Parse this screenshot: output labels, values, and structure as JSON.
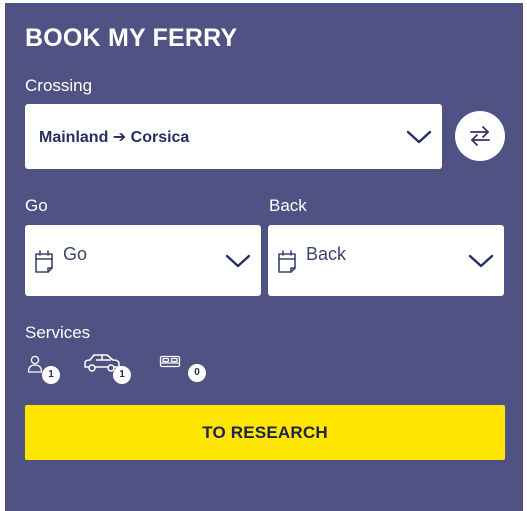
{
  "widget": {
    "title": "BOOK MY FERRY",
    "crossing_label": "Crossing",
    "crossing_value": "Mainland ➔ Corsica",
    "go_label": "Go",
    "back_label": "Back",
    "go_placeholder": "Go",
    "back_placeholder": "Back",
    "services_label": "Services",
    "services": [
      {
        "icon": "passenger-icon",
        "count": "1"
      },
      {
        "icon": "car-icon",
        "count": "1"
      },
      {
        "icon": "cabin-bed-icon",
        "count": "0"
      }
    ],
    "research_button": "TO RESEARCH"
  },
  "colors": {
    "panel_bg": "#4f5283",
    "button_bg": "#ffe600",
    "text_dark": "#252f63"
  }
}
